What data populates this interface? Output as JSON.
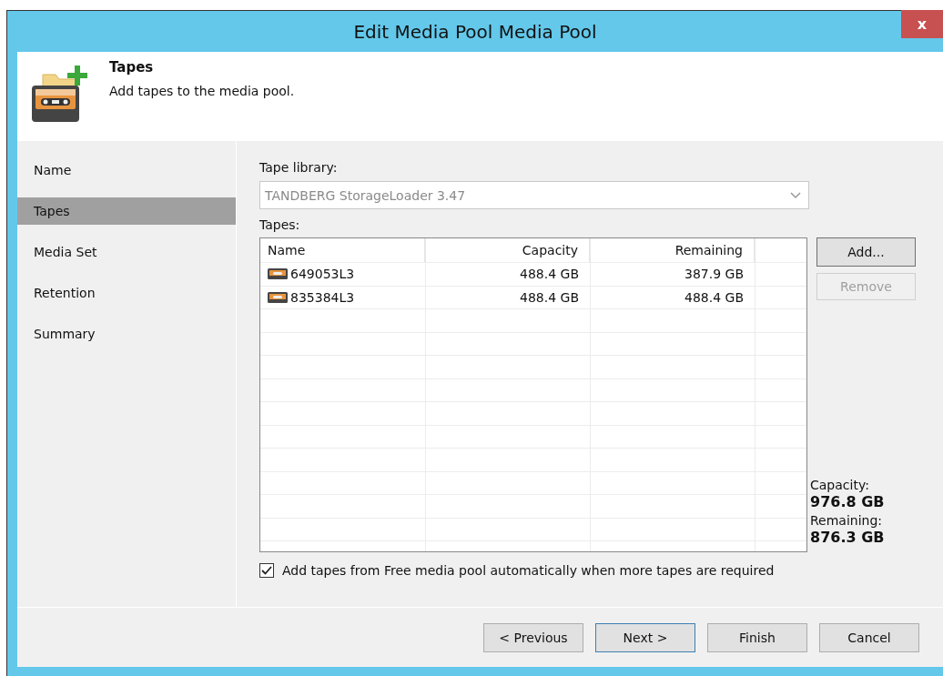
{
  "window": {
    "title": "Edit Media Pool Media Pool",
    "close_label": "x"
  },
  "header": {
    "title": "Tapes",
    "subtitle": "Add tapes to the media pool."
  },
  "steps": [
    {
      "label": "Name",
      "selected": false
    },
    {
      "label": "Tapes",
      "selected": true
    },
    {
      "label": "Media Set",
      "selected": false
    },
    {
      "label": "Retention",
      "selected": false
    },
    {
      "label": "Summary",
      "selected": false
    }
  ],
  "tape_library": {
    "label": "Tape library:",
    "value": "TANDBERG StorageLoader 3.47",
    "disabled": true
  },
  "tapes": {
    "label": "Tapes:",
    "columns": [
      "Name",
      "Capacity",
      "Remaining"
    ],
    "rows": [
      {
        "name": "649053L3",
        "capacity": "488.4 GB",
        "remaining": "387.9 GB"
      },
      {
        "name": "835384L3",
        "capacity": "488.4 GB",
        "remaining": "488.4 GB"
      }
    ]
  },
  "side_buttons": [
    {
      "label": "Add...",
      "disabled": false
    },
    {
      "label": "Remove",
      "disabled": true
    }
  ],
  "totals": [
    {
      "label": "Capacity:",
      "value": "976.8 GB"
    },
    {
      "label": "Remaining:",
      "value": "876.3 GB"
    }
  ],
  "auto_add": {
    "label": "Add tapes from Free media pool automatically when more tapes are required",
    "checked": true
  },
  "footer_buttons": [
    {
      "label": "< Previous",
      "focused": false
    },
    {
      "label": "Next >",
      "focused": true
    },
    {
      "label": "Finish",
      "focused": false
    },
    {
      "label": "Cancel",
      "focused": false
    }
  ]
}
